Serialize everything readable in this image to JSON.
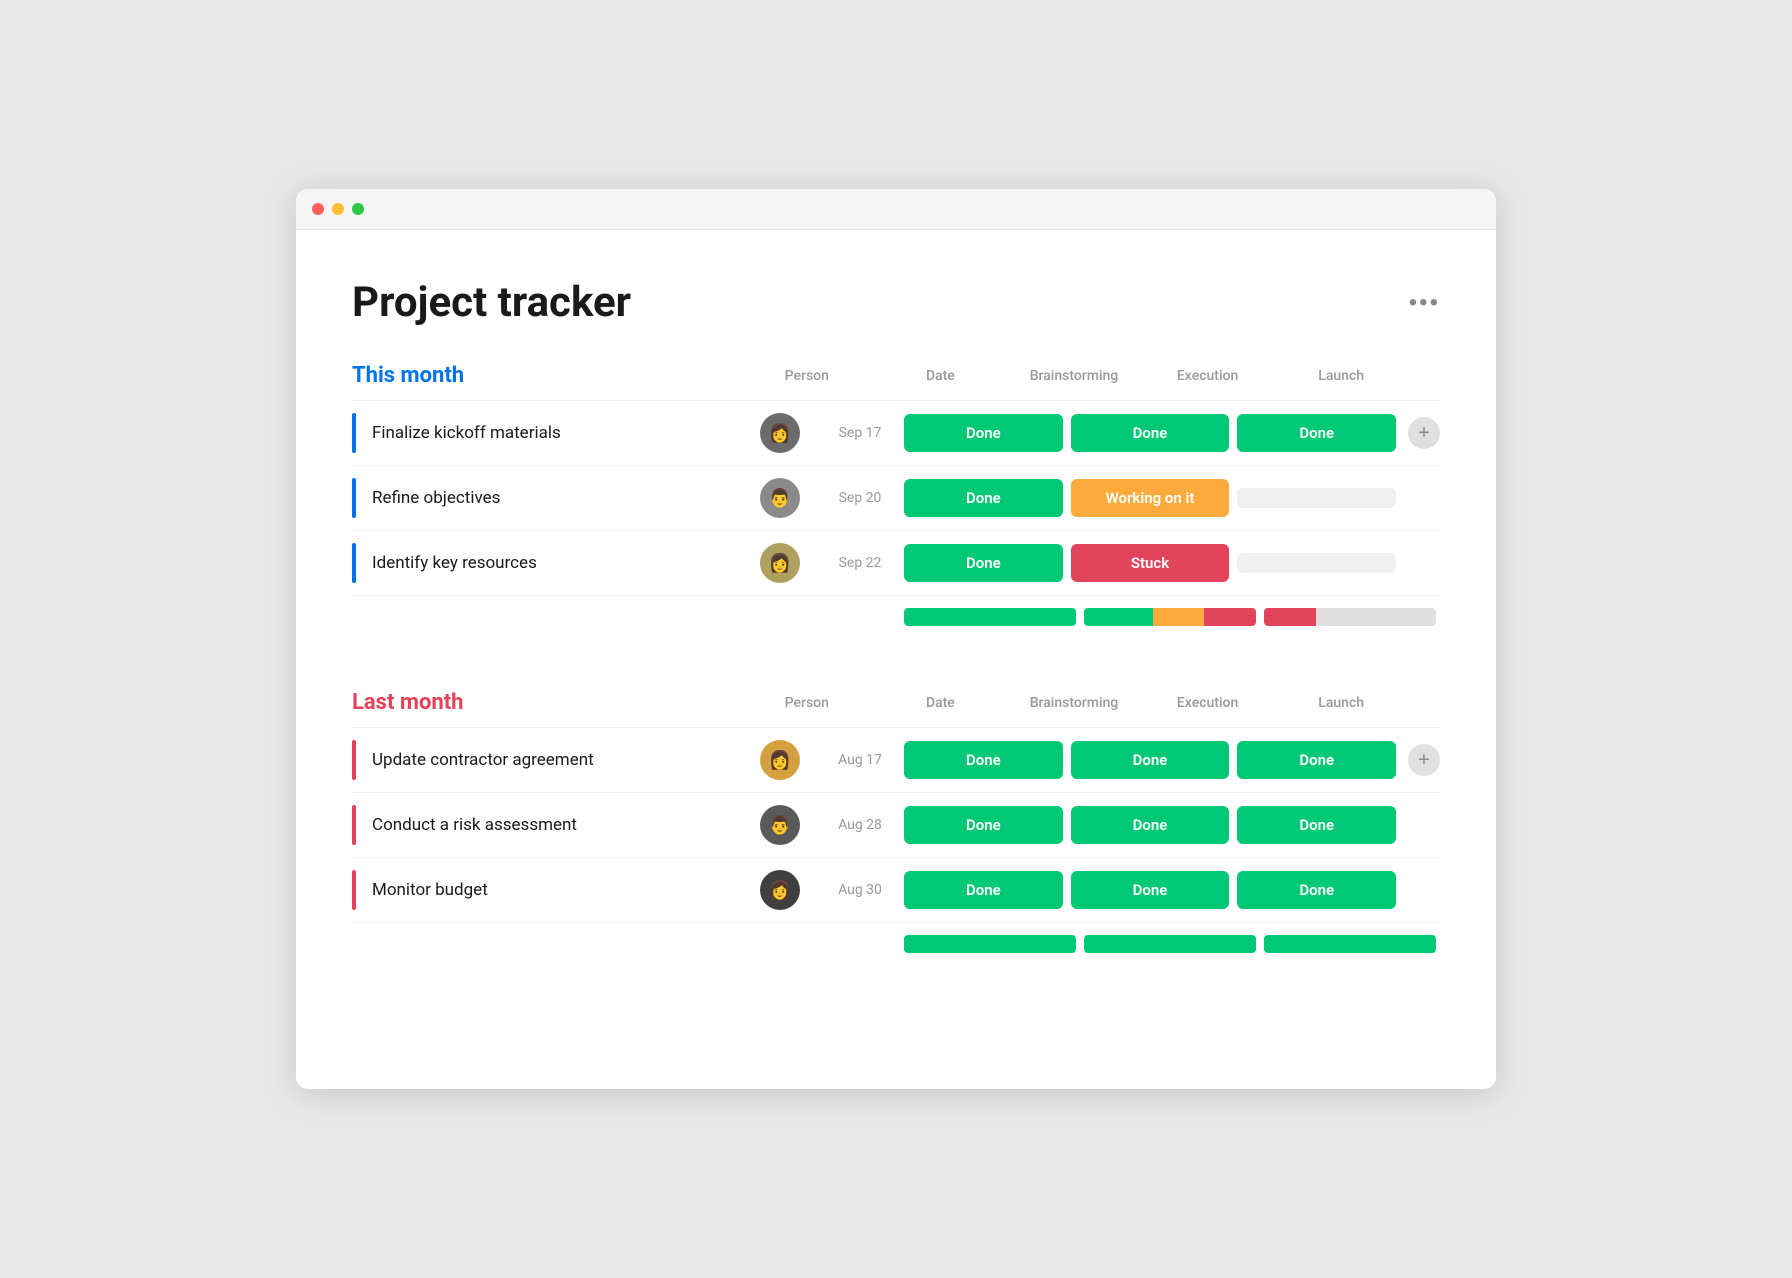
{
  "window": {
    "title": "Project tracker"
  },
  "page": {
    "title": "Project tracker",
    "more_label": "•••"
  },
  "sections": [
    {
      "id": "this-month",
      "title": "This month",
      "color": "blue",
      "columns": [
        "Person",
        "Date",
        "Brainstorming",
        "Execution",
        "Launch"
      ],
      "rows": [
        {
          "task": "Finalize kickoff materials",
          "date": "Sep 17",
          "avatar": "👩",
          "avatar_class": "av1",
          "statuses": [
            "done",
            "done",
            "done"
          ]
        },
        {
          "task": "Refine objectives",
          "date": "Sep 20",
          "avatar": "👨",
          "avatar_class": "av2",
          "statuses": [
            "done",
            "working",
            "empty"
          ]
        },
        {
          "task": "Identify key resources",
          "date": "Sep 22",
          "avatar": "👩",
          "avatar_class": "av3",
          "statuses": [
            "done",
            "stuck",
            "empty"
          ]
        }
      ],
      "summary_bars": [
        {
          "segments": [
            {
              "color": "#00c875",
              "pct": 100
            }
          ]
        },
        {
          "segments": [
            {
              "color": "#00c875",
              "pct": 40
            },
            {
              "color": "#fdab3d",
              "pct": 30
            },
            {
              "color": "#e2445c",
              "pct": 30
            }
          ]
        },
        {
          "segments": [
            {
              "color": "#e2445c",
              "pct": 30
            },
            {
              "color": "#e0e0e0",
              "pct": 70
            }
          ]
        }
      ]
    },
    {
      "id": "last-month",
      "title": "Last month",
      "color": "red",
      "columns": [
        "Person",
        "Date",
        "Brainstorming",
        "Execution",
        "Launch"
      ],
      "rows": [
        {
          "task": "Update contractor agreement",
          "date": "Aug 17",
          "avatar": "👩",
          "avatar_class": "av4",
          "statuses": [
            "done",
            "done",
            "done"
          ]
        },
        {
          "task": "Conduct a risk assessment",
          "date": "Aug 28",
          "avatar": "👨",
          "avatar_class": "av5",
          "statuses": [
            "done",
            "done",
            "done"
          ]
        },
        {
          "task": "Monitor budget",
          "date": "Aug 30",
          "avatar": "👩",
          "avatar_class": "av6",
          "statuses": [
            "done",
            "done",
            "done"
          ]
        }
      ],
      "summary_bars": [
        {
          "segments": [
            {
              "color": "#00c875",
              "pct": 100
            }
          ]
        },
        {
          "segments": [
            {
              "color": "#00c875",
              "pct": 100
            }
          ]
        },
        {
          "segments": [
            {
              "color": "#00c875",
              "pct": 100
            }
          ]
        }
      ]
    }
  ],
  "status_labels": {
    "done": "Done",
    "working": "Working on it",
    "stuck": "Stuck",
    "empty": ""
  }
}
